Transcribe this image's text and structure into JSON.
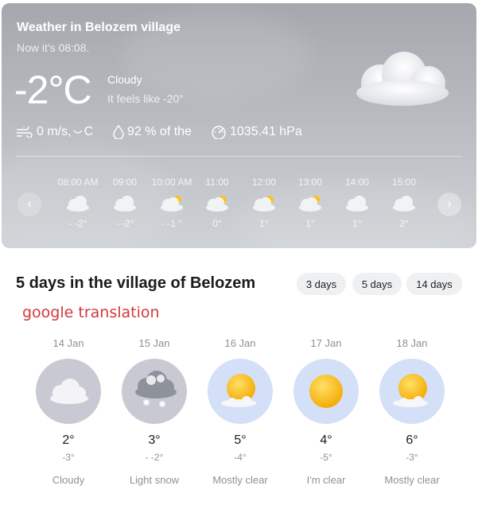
{
  "current": {
    "title": "Weather in Belozem village",
    "subtitle": "Now it's 08:08.",
    "temperature": "-2°C",
    "condition": "Cloudy",
    "feels_like": "It feels like -20°",
    "condition_icon": "cloud-icon",
    "wind": "0 m/s, ",
    "wind_direction": "C",
    "humidity": "92 % of the",
    "pressure": "1035.41 hPa",
    "hours": [
      {
        "time": "08:00 AM",
        "temp": "- -2°",
        "icon": "cloud-icon"
      },
      {
        "time": "09:00",
        "temp": "- -2°",
        "icon": "cloud-icon"
      },
      {
        "time": "10:00 AM",
        "temp": "- -1 °",
        "icon": "partly-cloudy-icon"
      },
      {
        "time": "11:00",
        "temp": "0°",
        "icon": "partly-cloudy-icon"
      },
      {
        "time": "12:00",
        "temp": "1°",
        "icon": "partly-cloudy-icon"
      },
      {
        "time": "13:00",
        "temp": "1°",
        "icon": "partly-cloudy-icon"
      },
      {
        "time": "14:00",
        "temp": "1°",
        "icon": "cloud-icon"
      },
      {
        "time": "15:00",
        "temp": "2°",
        "icon": "cloud-icon"
      }
    ],
    "prev_label": "‹",
    "next_label": "›"
  },
  "forecast": {
    "title": "5 days in the village of Belozem",
    "chips": [
      "3 days",
      "5 days",
      "14 days"
    ],
    "translation_note": "google translation",
    "days": [
      {
        "date": "14 Jan",
        "high": "2°",
        "low": "-3°",
        "desc": "Cloudy",
        "icon": "cloud-icon"
      },
      {
        "date": "15 Jan",
        "high": "3°",
        "low": "- -2°",
        "desc": "Light snow",
        "icon": "snow-cloud-icon"
      },
      {
        "date": "16 Jan",
        "high": "5°",
        "low": "-4°",
        "desc": "Mostly clear",
        "icon": "sun-cloud-icon"
      },
      {
        "date": "17 Jan",
        "high": "4°",
        "low": "-5°",
        "desc": "I'm clear",
        "icon": "sun-icon"
      },
      {
        "date": "18 Jan",
        "high": "6°",
        "low": "-3°",
        "desc": "Mostly clear",
        "icon": "sun-cloud-icon"
      }
    ]
  },
  "colors": {
    "card_top": "#a4a8ae",
    "card_bottom": "#cfd2d6",
    "translation_red": "#d4383a",
    "chip_bg": "#eff0f2",
    "circle_grey": "#c9c9d3",
    "circle_blue": "#d4e0f7",
    "sun": "#ffc21a"
  }
}
